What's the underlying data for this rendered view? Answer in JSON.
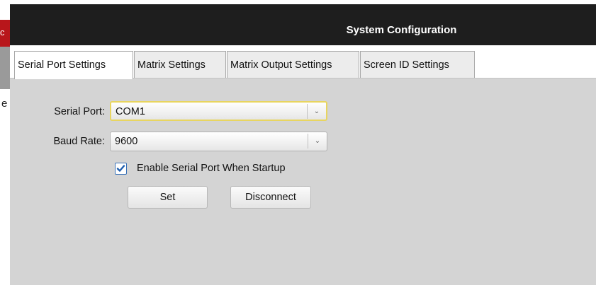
{
  "window": {
    "title": "System Configuration"
  },
  "background": {
    "red_glyph": "c",
    "side_letter": "e"
  },
  "tabs": [
    {
      "label": "Serial Port Settings",
      "active": true
    },
    {
      "label": "Matrix Settings",
      "active": false
    },
    {
      "label": "Matrix Output Settings",
      "active": false
    },
    {
      "label": "Screen ID Settings",
      "active": false
    }
  ],
  "serial": {
    "port_label": "Serial Port:",
    "port_value": "COM1",
    "baud_label": "Baud Rate:",
    "baud_value": "9600",
    "enable_label": "Enable Serial Port When Startup",
    "enable_checked": true,
    "set_label": "Set",
    "disconnect_label": "Disconnect"
  },
  "icons": {
    "dropdown": "chevron-down-icon",
    "check": "checkmark-icon"
  },
  "colors": {
    "titlebar": "#1e1e1e",
    "accent_red": "#b8161b",
    "focus_border": "#e8d560",
    "checkbox_border": "#3a72b8",
    "panel": "#d4d4d4"
  }
}
